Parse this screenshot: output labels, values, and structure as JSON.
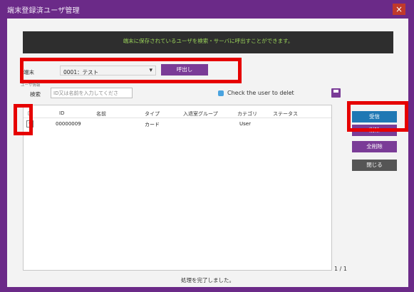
{
  "window": {
    "title": "端末登録済ユーザ管理",
    "close_label": "×"
  },
  "banner": {
    "text": "端末に保存されているユーザを検索・サーバに呼出すことができます。"
  },
  "terminal": {
    "label": "端末",
    "selected": "0001：テスト",
    "call_button": "呼出し"
  },
  "search": {
    "label": "検索",
    "placeholder": "ID又は名前を入力してくださ",
    "section_label": "ユーザ情報"
  },
  "check_note": "Check the user to delet",
  "icons": {
    "save": "floppy-disk-icon",
    "dropdown": "chevron-down-icon",
    "close": "close-icon"
  },
  "table": {
    "headers": [
      "□",
      "ID",
      "名前",
      "タイプ",
      "入退室グループ",
      "カテゴリ",
      "ステータス"
    ],
    "rows": [
      {
        "checked": true,
        "id": "00000009",
        "name": "",
        "type": "カード",
        "group": "",
        "category": "User",
        "status": ""
      }
    ]
  },
  "side_buttons": {
    "receive": "受信",
    "delete": "削除",
    "delete_all": "全削除",
    "close": "閉じる"
  },
  "pager": "1 / 1",
  "status": "処理を完了しました。",
  "colors": {
    "accent_purple": "#7a3c97",
    "accent_blue": "#1f78b4",
    "highlight_red": "#e60000",
    "banner_text": "#9bd45a"
  }
}
